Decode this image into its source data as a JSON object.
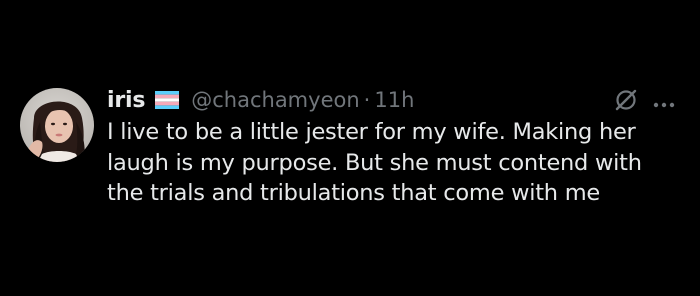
{
  "tweet": {
    "display_name": "iris",
    "flag_icon": "transgender-flag-icon",
    "handle": "@chachamyeon",
    "separator": "·",
    "time": "11h",
    "text_lines": [
      "I live to be a little jester for my wife. Making her",
      "laugh is my purpose. But she must contend with",
      "the trials and tribulations that come with me"
    ]
  },
  "icons": {
    "grok": "grok-icon",
    "more": "more-icon"
  },
  "colors": {
    "background": "#000000",
    "primary_text": "#e7e9ea",
    "secondary_text": "#71767b",
    "flag_blue": "#5BCEFA",
    "flag_pink": "#F5A9B8",
    "flag_white": "#FFFFFF"
  }
}
